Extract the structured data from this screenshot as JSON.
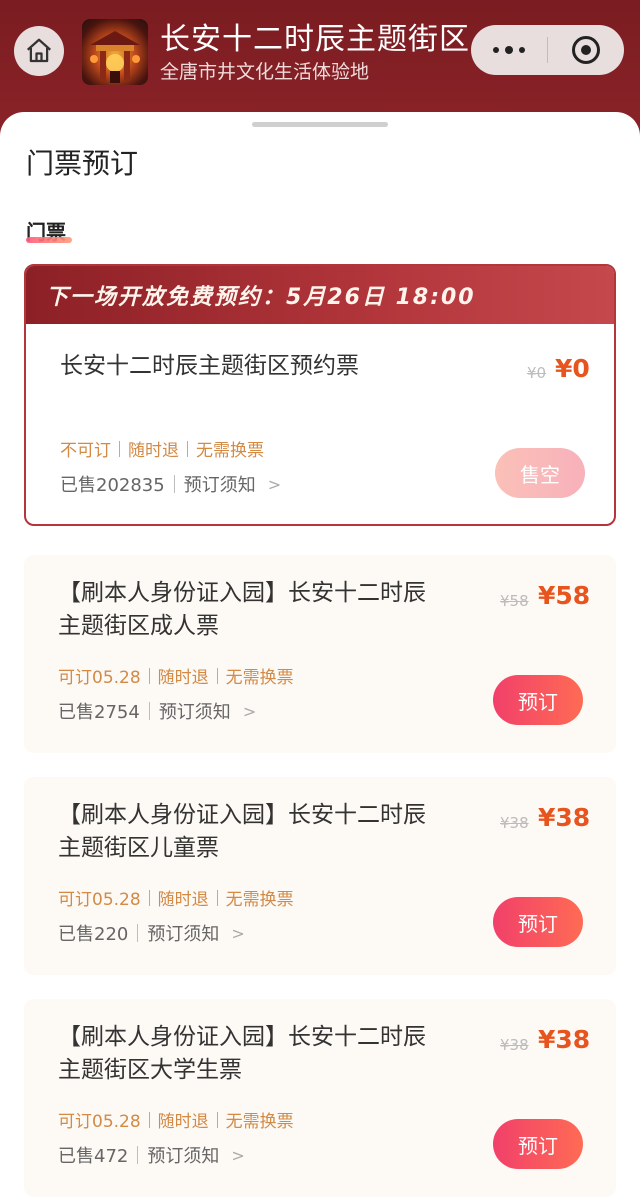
{
  "header": {
    "title": "长安十二时辰主题街区",
    "subtitle": "全唐市井文化生活体验地"
  },
  "sheet": {
    "title": "门票预订",
    "section_label": "门票"
  },
  "featured": {
    "banner": "下一场开放免费预约：5月26日 18:00",
    "name": "长安十二时辰主题街区预约票",
    "orig_price": "¥0",
    "price": "¥0",
    "tags": [
      "不可订",
      "随时退",
      "无需换票"
    ],
    "sold": "已售202835",
    "notice": "预订须知",
    "button": "售空"
  },
  "tickets": [
    {
      "name": "【刷本人身份证入园】长安十二时辰主题街区成人票",
      "orig_price": "¥58",
      "price": "¥58",
      "tags": [
        "可订05.28",
        "随时退",
        "无需换票"
      ],
      "sold": "已售2754",
      "notice": "预订须知",
      "button": "预订"
    },
    {
      "name": "【刷本人身份证入园】长安十二时辰主题街区儿童票",
      "orig_price": "¥38",
      "price": "¥38",
      "tags": [
        "可订05.28",
        "随时退",
        "无需换票"
      ],
      "sold": "已售220",
      "notice": "预订须知",
      "button": "预订"
    },
    {
      "name": "【刷本人身份证入园】长安十二时辰主题街区大学生票",
      "orig_price": "¥38",
      "price": "¥38",
      "tags": [
        "可订05.28",
        "随时退",
        "无需换票"
      ],
      "sold": "已售472",
      "notice": "预订须知",
      "button": "预订"
    }
  ],
  "colors": {
    "header_bg": "#7a1c21",
    "accent_price": "#e8541e",
    "tag_color": "#d38a45",
    "book_button": "#f1406a"
  },
  "icons": {
    "home": "home-icon",
    "more": "more-dots-icon",
    "close": "close-miniapp-icon",
    "chevron": "chevron-right-icon"
  }
}
